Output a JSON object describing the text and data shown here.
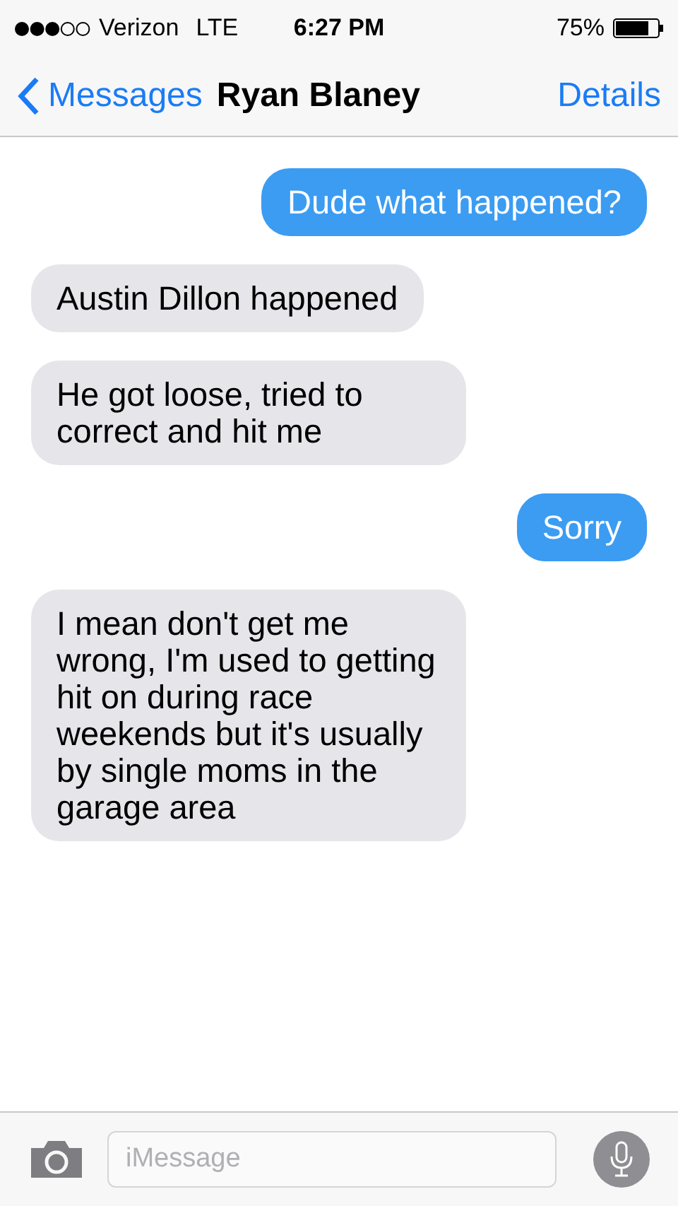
{
  "status_bar": {
    "carrier": "Verizon",
    "network": "LTE",
    "time": "6:27 PM",
    "battery": "75%"
  },
  "nav": {
    "back_label": "Messages",
    "title": "Ryan Blaney",
    "action": "Details"
  },
  "messages": [
    {
      "kind": "sent",
      "text": "Dude what happened?"
    },
    {
      "kind": "received",
      "text": "Austin Dillon happened"
    },
    {
      "kind": "received",
      "text": "He got loose, tried to correct and hit me"
    },
    {
      "kind": "sent",
      "text": "Sorry"
    },
    {
      "kind": "received",
      "text": "I mean don't get me wrong, I'm used to getting hit on during race weekends but it's usually by single moms in the garage area"
    }
  ],
  "input_bar": {
    "placeholder": "iMessage"
  }
}
